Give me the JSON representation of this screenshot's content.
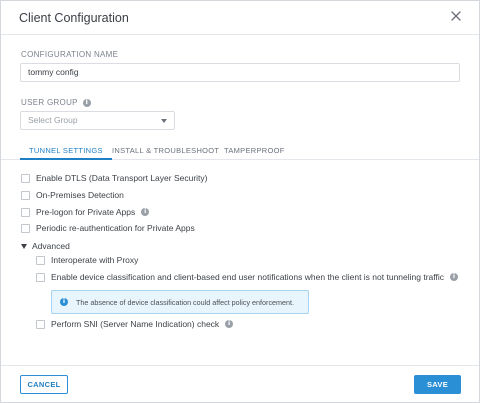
{
  "dialog": {
    "title": "Client Configuration",
    "close_icon": "close-icon"
  },
  "config_name": {
    "label": "CONFIGURATION NAME",
    "value": "tommy config"
  },
  "user_group": {
    "label": "USER GROUP",
    "placeholder": "Select Group"
  },
  "tabs": [
    {
      "label": "TUNNEL SETTINGS",
      "active": true
    },
    {
      "label": "INSTALL & TROUBLESHOOT",
      "active": false
    },
    {
      "label": "TAMPERPROOF",
      "active": false
    }
  ],
  "options": {
    "dtls": "Enable DTLS (Data Transport Layer Security)",
    "on_prem": "On-Premises Detection",
    "pre_logon": "Pre-logon for Private Apps",
    "periodic_reauth": "Periodic re-authentication for Private Apps"
  },
  "advanced": {
    "label": "Advanced",
    "interoperate": "Interoperate with Proxy",
    "device_classification": "Enable device classification and client-based end user notifications when the client is not tunneling traffic",
    "notice": "The absence of device classification could affect policy enforcement.",
    "sni_check": "Perform SNI (Server Name Indication) check"
  },
  "footer": {
    "cancel": "CANCEL",
    "save": "SAVE"
  },
  "colors": {
    "accent": "#2b8fd6",
    "notice_bg": "#e9f5fc",
    "notice_border": "#a6d4f0"
  }
}
